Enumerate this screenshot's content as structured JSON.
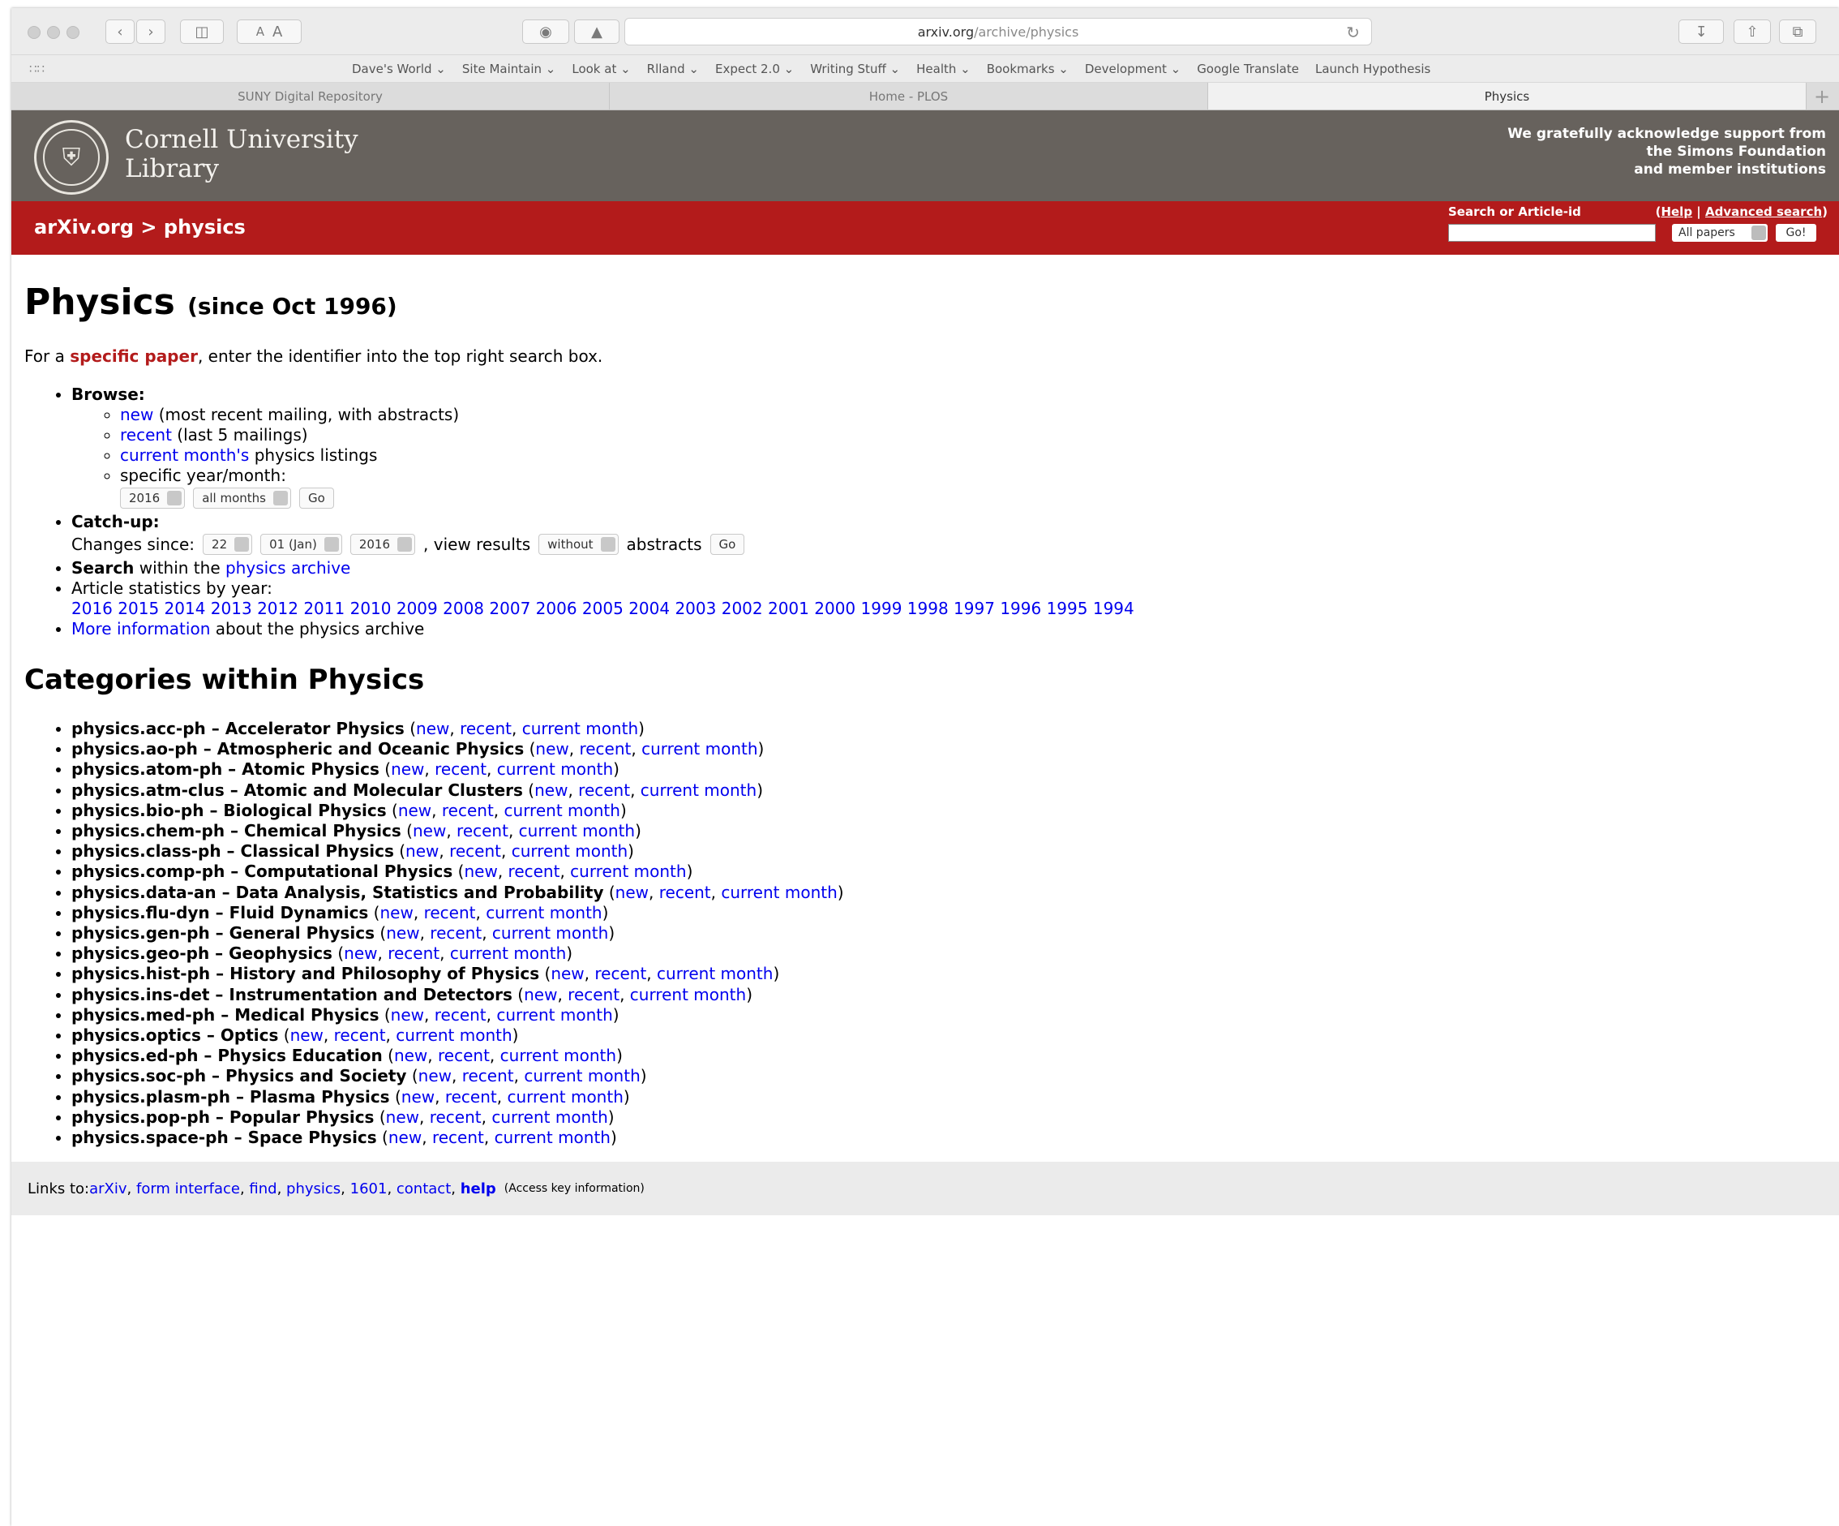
{
  "browser": {
    "url_host": "arxiv.org",
    "url_path": "/archive/physics",
    "text_size_small": "A",
    "text_size_large": "A",
    "bookmarks": [
      "Dave's World ⌄",
      "Site Maintain ⌄",
      "Look at ⌄",
      "Rlland ⌄",
      "Expect 2.0 ⌄",
      "Writing Stuff ⌄",
      "Health ⌄",
      "Bookmarks ⌄",
      "Development ⌄",
      "Google Translate",
      "Launch Hypothesis"
    ],
    "tabs": [
      "SUNY Digital Repository",
      "Home - PLOS",
      "Physics"
    ]
  },
  "header": {
    "org_line1": "Cornell University",
    "org_line2": "Library",
    "ack_line1": "We gratefully acknowledge support from",
    "ack_line2": "the Simons Foundation",
    "ack_line3": "and member institutions"
  },
  "redbar": {
    "crumb_site": "arXiv.org",
    "crumb_sep": " > ",
    "crumb_page": "physics",
    "search_label": "Search or Article-id",
    "help_open": "(",
    "help": "Help",
    "help_sep": " | ",
    "advanced": "Advanced search",
    "help_close": ")",
    "papers_select": "All papers",
    "go": "Go!"
  },
  "page": {
    "title": "Physics",
    "title_since": "(since Oct 1996)",
    "intro_pre": "For a ",
    "intro_link": "specific paper",
    "intro_post": ", enter the identifier into the top right search box.",
    "browse_label": "Browse:",
    "browse_new": "new",
    "browse_new_desc": " (most recent mailing, with abstracts)",
    "browse_recent": "recent",
    "browse_recent_desc": " (last 5 mailings)",
    "browse_current": "current month's",
    "browse_current_desc": " physics listings",
    "browse_specific": "specific year/month:",
    "year_select": "2016",
    "month_select": "all months",
    "go": "Go",
    "catchup_label": "Catch-up:",
    "changes_since": "Changes since:",
    "day_select": "22",
    "cmonth_select": "01 (Jan)",
    "cyear_select": "2016",
    "view_results": ", view results",
    "abstracts_select": "without",
    "abstracts_label": "abstracts",
    "search_bold": "Search",
    "search_within": " within the ",
    "search_link": "physics archive",
    "stats_label": "Article statistics by year:",
    "years": [
      "2016",
      "2015",
      "2014",
      "2013",
      "2012",
      "2011",
      "2010",
      "2009",
      "2008",
      "2007",
      "2006",
      "2005",
      "2004",
      "2003",
      "2002",
      "2001",
      "2000",
      "1999",
      "1998",
      "1997",
      "1996",
      "1995",
      "1994"
    ],
    "more_info": "More information",
    "more_info_post": " about the physics archive",
    "categories_heading": "Categories within Physics"
  },
  "categories": [
    {
      "code": "physics.acc-ph",
      "name": "Accelerator Physics"
    },
    {
      "code": "physics.ao-ph",
      "name": "Atmospheric and Oceanic Physics"
    },
    {
      "code": "physics.atom-ph",
      "name": "Atomic Physics"
    },
    {
      "code": "physics.atm-clus",
      "name": "Atomic and Molecular Clusters"
    },
    {
      "code": "physics.bio-ph",
      "name": "Biological Physics"
    },
    {
      "code": "physics.chem-ph",
      "name": "Chemical Physics"
    },
    {
      "code": "physics.class-ph",
      "name": "Classical Physics"
    },
    {
      "code": "physics.comp-ph",
      "name": "Computational Physics"
    },
    {
      "code": "physics.data-an",
      "name": "Data Analysis, Statistics and Probability"
    },
    {
      "code": "physics.flu-dyn",
      "name": "Fluid Dynamics"
    },
    {
      "code": "physics.gen-ph",
      "name": "General Physics"
    },
    {
      "code": "physics.geo-ph",
      "name": "Geophysics"
    },
    {
      "code": "physics.hist-ph",
      "name": "History and Philosophy of Physics"
    },
    {
      "code": "physics.ins-det",
      "name": "Instrumentation and Detectors"
    },
    {
      "code": "physics.med-ph",
      "name": "Medical Physics"
    },
    {
      "code": "physics.optics",
      "name": "Optics"
    },
    {
      "code": "physics.ed-ph",
      "name": "Physics Education"
    },
    {
      "code": "physics.soc-ph",
      "name": "Physics and Society"
    },
    {
      "code": "physics.plasm-ph",
      "name": "Plasma Physics"
    },
    {
      "code": "physics.pop-ph",
      "name": "Popular Physics"
    },
    {
      "code": "physics.space-ph",
      "name": "Space Physics"
    }
  ],
  "category_links": {
    "dash": " – ",
    "open": " (",
    "new": "new",
    "sep": ", ",
    "recent": "recent",
    "current": "current month",
    "close": ")"
  },
  "footer": {
    "links_to": "Links to: ",
    "links": [
      "arXiv",
      "form interface",
      "find",
      "physics",
      "1601",
      "contact",
      "help"
    ],
    "access_key": "(Access key information)"
  },
  "colors": {
    "header_gray": "#67625d",
    "arxiv_red": "#b31b1b",
    "link_blue": "#0000ee"
  }
}
